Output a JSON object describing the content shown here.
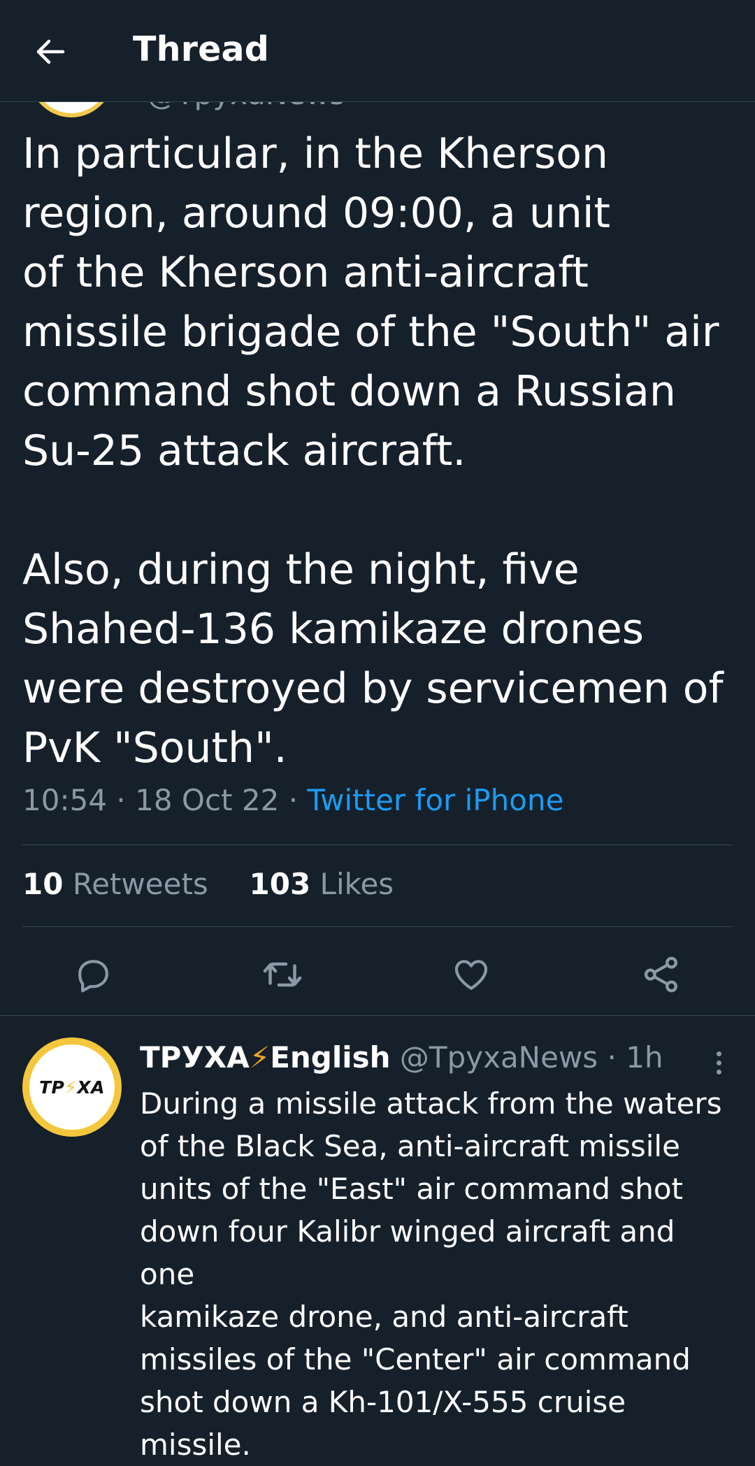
{
  "header": {
    "title": "Thread"
  },
  "main_tweet": {
    "peek_handle": "@TpyxaNews",
    "text": "In particular, in the Kherson\nregion, around 09:00, a unit\nof the Kherson anti-aircraft\nmissile brigade of the \"South\" air\ncommand shot down a Russian\nSu-25 attack aircraft.\n\nAlso, during the night, five\nShahed-136 kamikaze drones\nwere destroyed by servicemen of\nPvK \"South\".",
    "time": "10:54",
    "date": "18 Oct 22",
    "separator": "·",
    "source": "Twitter for iPhone",
    "stats": {
      "retweets_count": "10",
      "retweets_label": "Retweets",
      "likes_count": "103",
      "likes_label": "Likes"
    },
    "actions": [
      "reply-icon",
      "retweet-icon",
      "like-icon",
      "share-icon"
    ]
  },
  "reply_tweet": {
    "avatar_text_left": "ТР",
    "avatar_bolt": "⚡",
    "avatar_text_right": "ХА",
    "name_part1": "ТРУХА",
    "name_emoji": "⚡",
    "name_part2": "English",
    "handle": "@TpyxaNews",
    "separator": "·",
    "time": "1h",
    "text": "During a missile attack from the waters\nof the Black Sea, anti-aircraft missile\nunits of the \"East\" air command shot\ndown four Kalibr winged aircraft and one\nkamikaze drone, and anti-aircraft\nmissiles of the \"Center\" air command\nshot down a Kh-101/X-555 cruise\nmissile."
  },
  "colors": {
    "background": "#15202b",
    "primary_text": "#ffffff",
    "secondary_text": "#8b98a5",
    "link": "#1d9bf0",
    "divider": "#38444d",
    "avatar_ring": "#f4c63b"
  }
}
